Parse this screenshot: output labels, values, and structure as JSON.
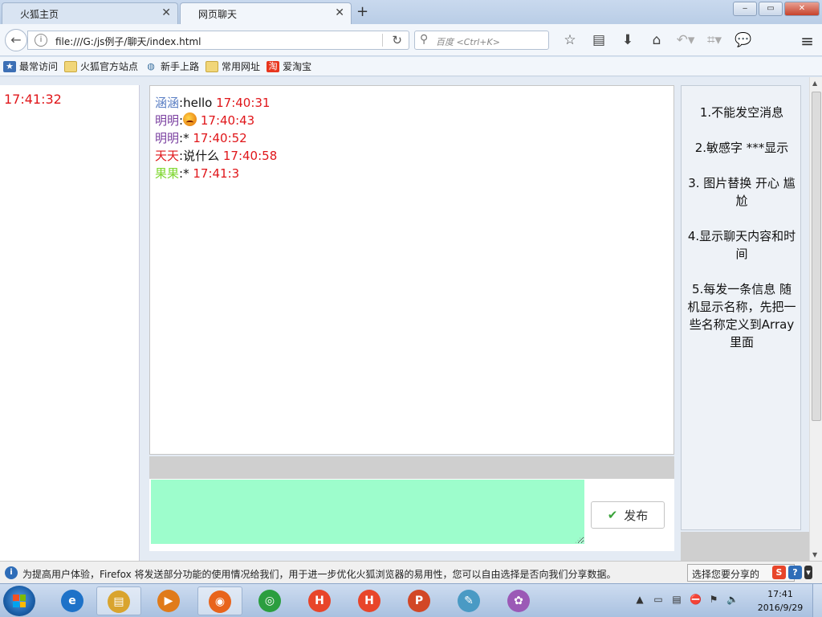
{
  "browser": {
    "tabs": [
      {
        "label": "火狐主页",
        "active": false
      },
      {
        "label": "网页聊天",
        "active": true
      }
    ],
    "url": "file:///G:/js例子/聊天/index.html",
    "search_placeholder": "百度 <Ctrl+K>",
    "window_controls": {
      "minimize": "‒",
      "maximize": "▭",
      "close": "✕"
    }
  },
  "bookmarks": [
    {
      "label": "最常访问",
      "icon": "most-visited-icon"
    },
    {
      "label": "火狐官方站点",
      "icon": "folder-icon"
    },
    {
      "label": "新手上路",
      "icon": "globe-icon"
    },
    {
      "label": "常用网址",
      "icon": "folder-icon"
    },
    {
      "label": "爱淘宝",
      "icon": "taobao-icon"
    }
  ],
  "page": {
    "clock": "17:41:32",
    "messages": [
      {
        "name": "涵涵",
        "name_color": "#5b7fc4",
        "text": "hello",
        "time": "17:40:31",
        "emoji": false
      },
      {
        "name": "明明",
        "name_color": "#7a3fa0",
        "text": "",
        "time": "17:40:43",
        "emoji": true
      },
      {
        "name": "明明",
        "name_color": "#7a3fa0",
        "text": "*",
        "time": "17:40:52",
        "emoji": false
      },
      {
        "name": "天天",
        "name_color": "#e0161a",
        "text": "说什么",
        "time": "17:40:58",
        "emoji": false
      },
      {
        "name": "果果",
        "name_color": "#7bd62a",
        "text": "*",
        "time": "17:41:3",
        "emoji": false
      }
    ],
    "input": {
      "value": "",
      "background": "#9dfdcc"
    },
    "send_label": "发布",
    "rules": [
      "1.不能发空消息",
      "2.敏感字 ***显示",
      "3. 图片替换 开心 尴尬",
      "4.显示聊天内容和时间",
      "5.每发一条信息 随机显示名称，先把一些名称定义到Array 里面"
    ]
  },
  "notification": {
    "text": "为提高用户体验，Firefox 将发送部分功能的使用情况给我们，用于进一步优化火狐浏览器的易用性，您可以自由选择是否向我们分享数据。",
    "button_label": "选择您要分享的"
  },
  "taskbar": {
    "time": "17:41",
    "date": "2016/9/29",
    "apps": [
      {
        "name": "ie",
        "glyph": "e",
        "color": "#1e72c8"
      },
      {
        "name": "explorer",
        "glyph": "▤",
        "color": "#d9a42e"
      },
      {
        "name": "media",
        "glyph": "▶",
        "color": "#e07b1a"
      },
      {
        "name": "firefox",
        "glyph": "◉",
        "color": "#e8641b"
      },
      {
        "name": "chrome",
        "glyph": "◎",
        "color": "#2b9e3f"
      },
      {
        "name": "hbuilder-1",
        "glyph": "H",
        "color": "#e8452a"
      },
      {
        "name": "hbuilder-2",
        "glyph": "H",
        "color": "#e8452a"
      },
      {
        "name": "powerpoint",
        "glyph": "P",
        "color": "#d24726"
      },
      {
        "name": "notes",
        "glyph": "✎",
        "color": "#4a9ac4"
      },
      {
        "name": "paint",
        "glyph": "✿",
        "color": "#9b59b6"
      }
    ]
  }
}
